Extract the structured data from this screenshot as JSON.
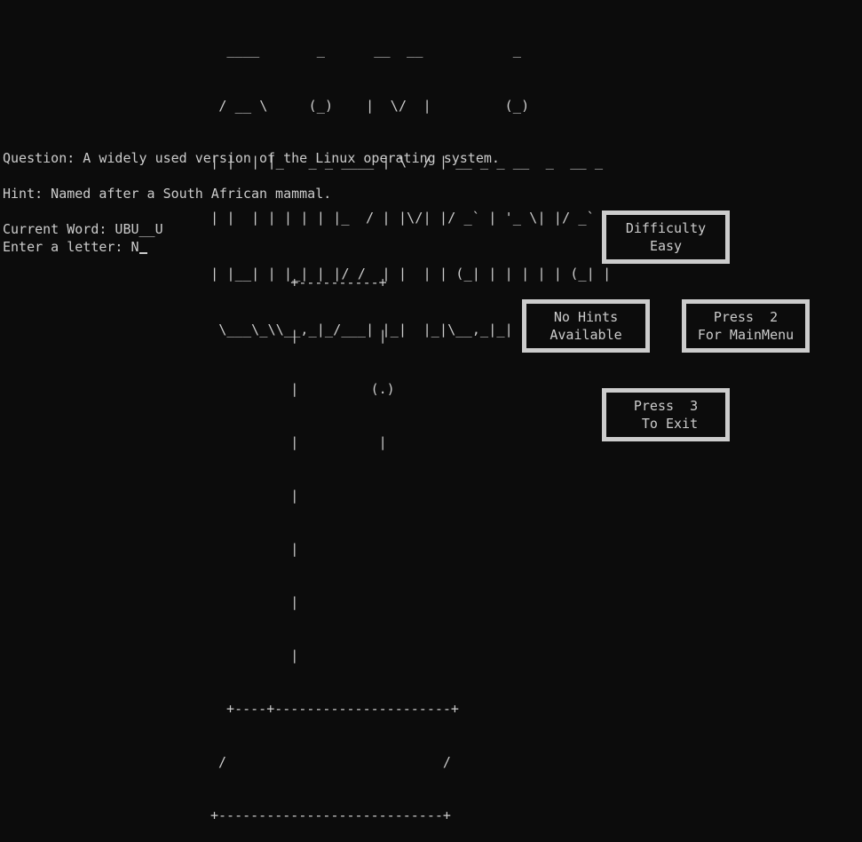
{
  "logo": {
    "lines": [
      "  ____       _      __  __           _",
      " / __ \\     (_)    |  \\/  |         (_)",
      "| |  | |_   _ _ ____ | \\  / | __ _ _ __  _  __ _",
      "| |  | | | | | |_  / | |\\/| |/ _` | '_ \\| |/ _` |",
      "| |__| | |_| | |/ /  | |  | | (_| | | | | | (_| |",
      " \\___\\_\\\\__,_|_/___| |_|  |_|\\__,_|_| |_|_|\\__,_|"
    ]
  },
  "question": "Question: A widely used version of the Linux operating system.",
  "hint": "Hint: Named after a South African mammal.",
  "current_word": "Current Word: UBU__U",
  "prompt": "Enter a letter: ",
  "typed": "N",
  "gallows": {
    "lines": [
      "          +----------+",
      "          |          |",
      "          |         (.)",
      "          |          |",
      "          |",
      "          |",
      "          |",
      "          |",
      "  +----+----------------------+",
      " /                           /",
      "+----------------------------+"
    ]
  },
  "buttons": {
    "difficulty": {
      "line1": "Difficulty",
      "line2": "Easy"
    },
    "hints": {
      "line1": "No Hints",
      "line2": "Available"
    },
    "menu": {
      "line1": "Press  2",
      "line2": "For MainMenu"
    },
    "exit": {
      "line1": "Press  3",
      "line2": " To Exit"
    }
  }
}
